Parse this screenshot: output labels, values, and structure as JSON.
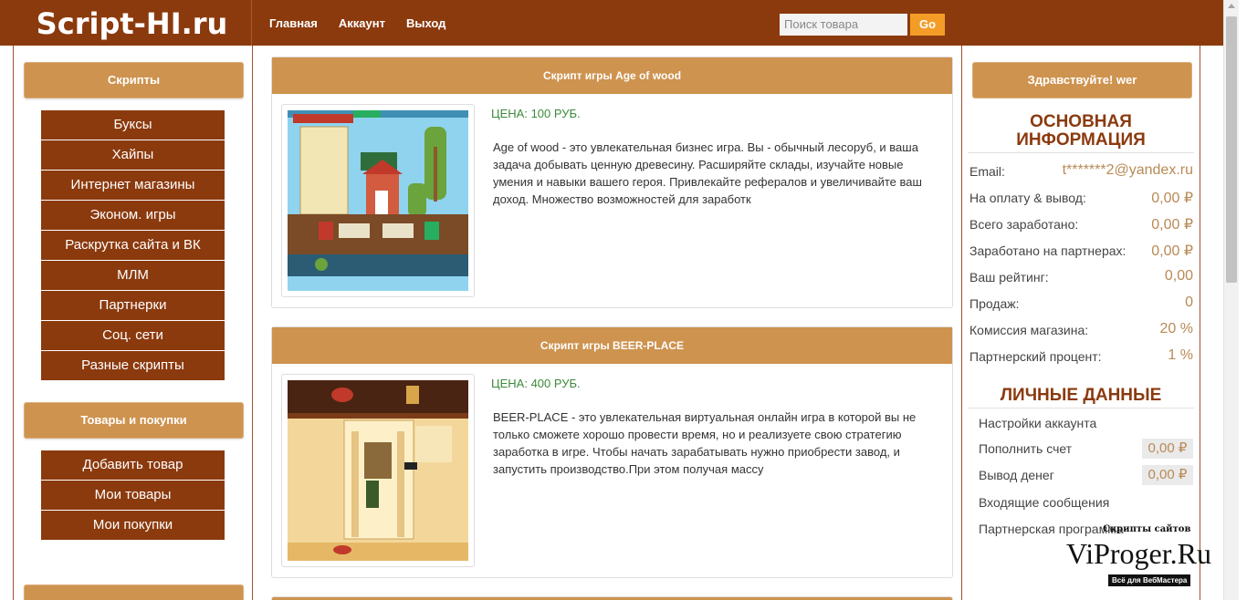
{
  "header": {
    "logo": "Script-HI.ru",
    "nav": [
      "Главная",
      "Аккаунт",
      "Выход"
    ],
    "search_placeholder": "Поиск товара",
    "go_label": "Go"
  },
  "left": {
    "scripts_title": "Скрипты",
    "scripts": [
      "Буксы",
      "Хайпы",
      "Интернет магазины",
      "Эконом. игры",
      "Раскрутка сайта и ВК",
      "МЛМ",
      "Партнерки",
      "Соц. сети",
      "Разные скрипты"
    ],
    "goods_title": "Товары и покупки",
    "goods": [
      "Добавить товар",
      "Мои товары",
      "Мои покупки"
    ]
  },
  "products": [
    {
      "title": "Скрипт игры Age of wood",
      "price": "ЦЕНА: 100 РУБ.",
      "desc": "Age of wood - это увлекательная бизнес игра. Вы - обычный лесоруб, и ваша задача добывать ценную древесину. Расширяйте склады, изучайте новые умения и навыки вашего героя. Привлекайте рефералов и увеличивайте ваш доход. Множество возможностей для заработк"
    },
    {
      "title": "Скрипт игры BEER-PLACE",
      "price": "ЦЕНА: 400 РУБ.",
      "desc": "BEER-PLACE - это увлекательная виртуальная онлайн игра в которой вы не только сможете хорошо провести время, но и реализуете свою стратегию заработка в игре. Чтобы начать зарабатывать нужно приобрести завод, и запустить производство.При этом получая массу"
    }
  ],
  "right": {
    "greeting": "Здравствуйте! wer",
    "main_info_title_1": "ОСНОВНАЯ",
    "main_info_title_2": "ИНФОРМАЦИЯ",
    "info": [
      {
        "k": "Email:",
        "v": "t*******2@yandex.ru"
      },
      {
        "k": "На оплату & вывод:",
        "v": "0,00 ₽"
      },
      {
        "k": "Всего заработано:",
        "v": "0,00 ₽"
      },
      {
        "k": "Заработано на партнерах:",
        "v": "0,00 ₽"
      },
      {
        "k": "Ваш рейтинг:",
        "v": "0,00"
      },
      {
        "k": "Продаж:",
        "v": "0"
      },
      {
        "k": "Комиссия магазина:",
        "v": "20 %"
      },
      {
        "k": "Партнерский процент:",
        "v": "1 %"
      }
    ],
    "personal_title": "ЛИЧНЫЕ ДАННЫЕ",
    "personal": [
      {
        "k": "Настройки аккаунта",
        "v": ""
      },
      {
        "k": "Пополнить счет",
        "v": "0,00 ₽"
      },
      {
        "k": "Вывод денег",
        "v": "0,00 ₽"
      },
      {
        "k": "Входящие сообщения",
        "v": ""
      },
      {
        "k": "Партнерская программа",
        "v": ""
      }
    ]
  },
  "watermark": {
    "top": "Скрипты сайтов",
    "main": "ViProger.Ru",
    "bottom": "Всё для ВебМастера"
  },
  "colors": {
    "brand": "#8b3a0e",
    "accent": "#ce934f",
    "go": "#f39c27",
    "price": "#3c8a3c"
  }
}
